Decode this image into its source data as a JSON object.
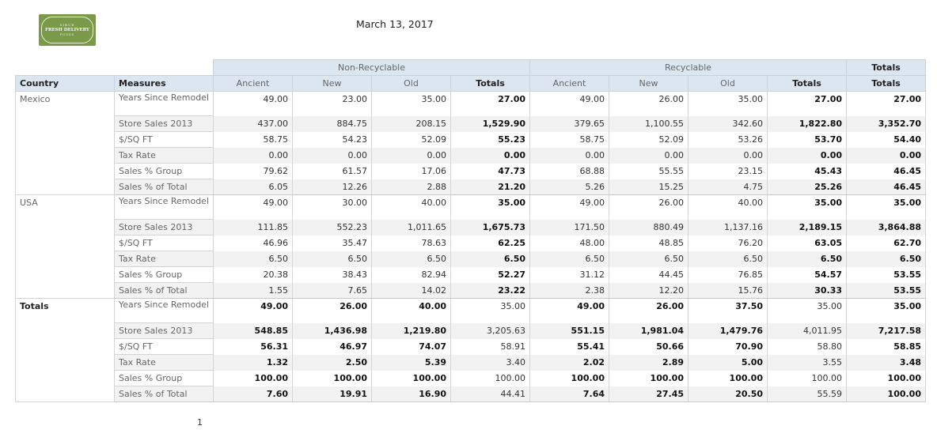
{
  "logo": {
    "line1": "SINCE",
    "line2": "FRESH DELIVERY",
    "line3": "FOODS"
  },
  "report": {
    "date": "March 13, 2017",
    "page": "1"
  },
  "headers": {
    "country": "Country",
    "measures": "Measures",
    "non_recyclable": "Non-Recyclable",
    "recyclable": "Recyclable",
    "totals": "Totals",
    "columns": [
      "Ancient",
      "New",
      "Old",
      "Totals",
      "Ancient",
      "New",
      "Old",
      "Totals",
      "Totals"
    ]
  },
  "groups": [
    {
      "country": "Mexico",
      "rows": [
        {
          "measure": "Years Since Remodel",
          "values": [
            "49.00",
            "23.00",
            "35.00",
            "27.00",
            "49.00",
            "26.00",
            "35.00",
            "27.00",
            "27.00"
          ]
        },
        {
          "measure": "Store Sales 2013",
          "values": [
            "437.00",
            "884.75",
            "208.15",
            "1,529.90",
            "379.65",
            "1,100.55",
            "342.60",
            "1,822.80",
            "3,352.70"
          ]
        },
        {
          "measure": "$/SQ FT",
          "values": [
            "58.75",
            "54.23",
            "52.09",
            "55.23",
            "58.75",
            "52.09",
            "53.26",
            "53.70",
            "54.40"
          ]
        },
        {
          "measure": "Tax Rate",
          "values": [
            "0.00",
            "0.00",
            "0.00",
            "0.00",
            "0.00",
            "0.00",
            "0.00",
            "0.00",
            "0.00"
          ]
        },
        {
          "measure": "Sales % Group",
          "values": [
            "79.62",
            "61.57",
            "17.06",
            "47.73",
            "68.88",
            "55.55",
            "23.15",
            "45.43",
            "46.45"
          ]
        },
        {
          "measure": "Sales % of Total",
          "values": [
            "6.05",
            "12.26",
            "2.88",
            "21.20",
            "5.26",
            "15.25",
            "4.75",
            "25.26",
            "46.45"
          ]
        }
      ]
    },
    {
      "country": "USA",
      "rows": [
        {
          "measure": "Years Since Remodel",
          "values": [
            "49.00",
            "30.00",
            "40.00",
            "35.00",
            "49.00",
            "26.00",
            "40.00",
            "35.00",
            "35.00"
          ]
        },
        {
          "measure": "Store Sales 2013",
          "values": [
            "111.85",
            "552.23",
            "1,011.65",
            "1,675.73",
            "171.50",
            "880.49",
            "1,137.16",
            "2,189.15",
            "3,864.88"
          ]
        },
        {
          "measure": "$/SQ FT",
          "values": [
            "46.96",
            "35.47",
            "78.63",
            "62.25",
            "48.00",
            "48.85",
            "76.20",
            "63.05",
            "62.70"
          ]
        },
        {
          "measure": "Tax Rate",
          "values": [
            "6.50",
            "6.50",
            "6.50",
            "6.50",
            "6.50",
            "6.50",
            "6.50",
            "6.50",
            "6.50"
          ]
        },
        {
          "measure": "Sales % Group",
          "values": [
            "20.38",
            "38.43",
            "82.94",
            "52.27",
            "31.12",
            "44.45",
            "76.85",
            "54.57",
            "53.55"
          ]
        },
        {
          "measure": "Sales % of Total",
          "values": [
            "1.55",
            "7.65",
            "14.02",
            "23.22",
            "2.38",
            "12.20",
            "15.76",
            "30.33",
            "53.55"
          ]
        }
      ]
    },
    {
      "country": "Totals",
      "rows": [
        {
          "measure": "Years Since Remodel",
          "values": [
            "49.00",
            "26.00",
            "40.00",
            "35.00",
            "49.00",
            "26.00",
            "37.50",
            "35.00",
            "35.00"
          ]
        },
        {
          "measure": "Store Sales 2013",
          "values": [
            "548.85",
            "1,436.98",
            "1,219.80",
            "3,205.63",
            "551.15",
            "1,981.04",
            "1,479.76",
            "4,011.95",
            "7,217.58"
          ]
        },
        {
          "measure": "$/SQ FT",
          "values": [
            "56.31",
            "46.97",
            "74.07",
            "58.91",
            "55.41",
            "50.66",
            "70.90",
            "58.80",
            "58.85"
          ]
        },
        {
          "measure": "Tax Rate",
          "values": [
            "1.32",
            "2.50",
            "5.39",
            "3.40",
            "2.02",
            "2.89",
            "5.00",
            "3.55",
            "3.48"
          ]
        },
        {
          "measure": "Sales % Group",
          "values": [
            "100.00",
            "100.00",
            "100.00",
            "100.00",
            "100.00",
            "100.00",
            "100.00",
            "100.00",
            "100.00"
          ]
        },
        {
          "measure": "Sales % of Total",
          "values": [
            "7.60",
            "19.91",
            "16.90",
            "44.41",
            "7.64",
            "27.45",
            "20.50",
            "55.59",
            "100.00"
          ]
        }
      ]
    }
  ]
}
